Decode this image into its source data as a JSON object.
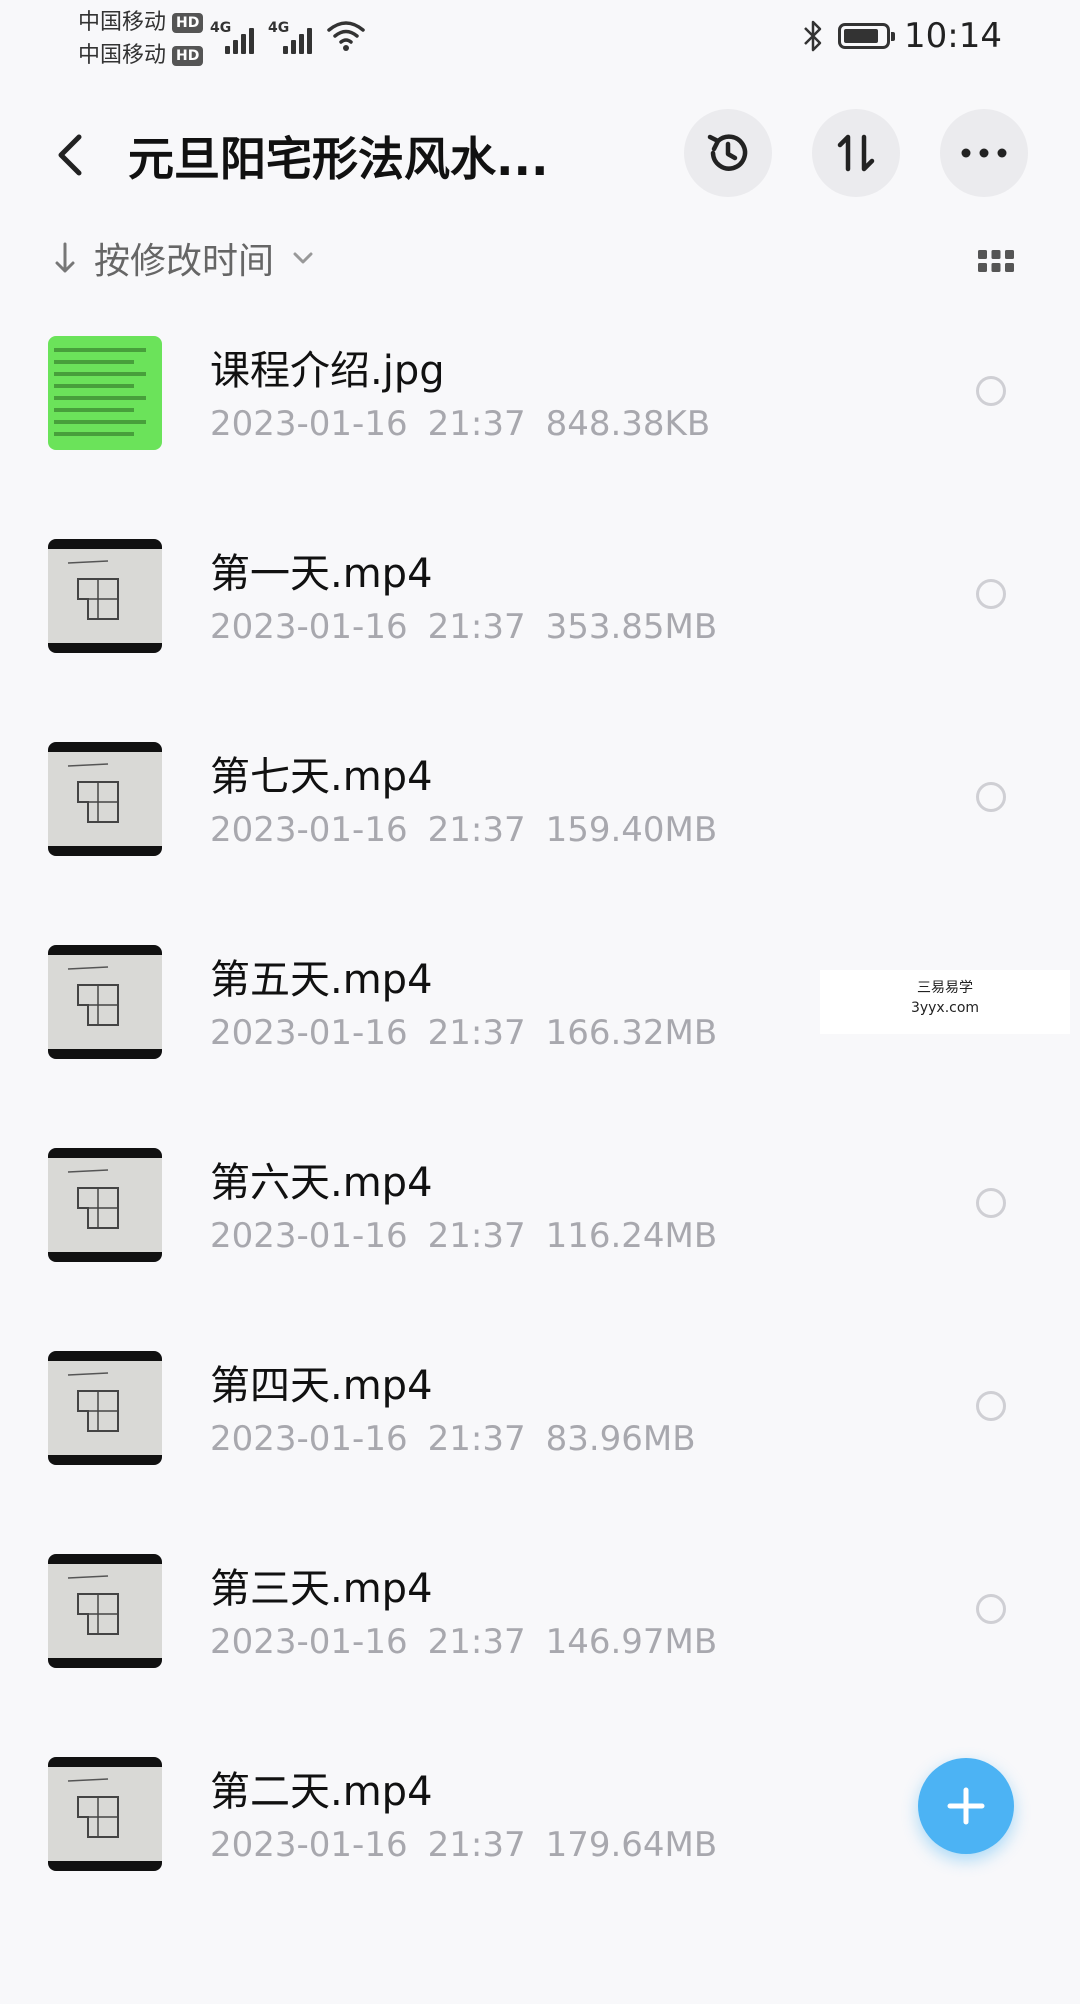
{
  "status_bar": {
    "carrier_1": "中国移动",
    "carrier_2": "中国移动",
    "hd_badge": "HD",
    "network_1": "4G",
    "network_2": "4G",
    "time": "10:14",
    "icons": [
      "signal-icon",
      "wifi-icon",
      "bluetooth-icon",
      "battery-icon"
    ],
    "battery_level": 0.85
  },
  "header": {
    "title": "元旦阳宅形法风水...",
    "icons": [
      "back-icon",
      "history-icon",
      "sort-icon",
      "more-icon"
    ]
  },
  "sort": {
    "label": "按修改时间",
    "icons": [
      "down-arrow-icon",
      "chevron-down-icon",
      "grid-view-icon"
    ]
  },
  "files": [
    {
      "name": "课程介绍.jpg",
      "date": "2023-01-16",
      "time": "21:37",
      "size": "848.38KB",
      "thumb": "image"
    },
    {
      "name": "第一天.mp4",
      "date": "2023-01-16",
      "time": "21:37",
      "size": "353.85MB",
      "thumb": "video"
    },
    {
      "name": "第七天.mp4",
      "date": "2023-01-16",
      "time": "21:37",
      "size": "159.40MB",
      "thumb": "video"
    },
    {
      "name": "第五天.mp4",
      "date": "2023-01-16",
      "time": "21:37",
      "size": "166.32MB",
      "thumb": "video"
    },
    {
      "name": "第六天.mp4",
      "date": "2023-01-16",
      "time": "21:37",
      "size": "116.24MB",
      "thumb": "video"
    },
    {
      "name": "第四天.mp4",
      "date": "2023-01-16",
      "time": "21:37",
      "size": "83.96MB",
      "thumb": "video"
    },
    {
      "name": "第三天.mp4",
      "date": "2023-01-16",
      "time": "21:37",
      "size": "146.97MB",
      "thumb": "video"
    },
    {
      "name": "第二天.mp4",
      "date": "2023-01-16",
      "time": "21:37",
      "size": "179.64MB",
      "thumb": "video"
    }
  ],
  "watermark": {
    "line1": "三易易学",
    "line2": "3yyx.com"
  },
  "fab_icon": "plus-icon",
  "colors": {
    "accent": "#4cb3f4",
    "background": "#f8f8fa",
    "meta_text": "#a8a8ae",
    "image_thumb": "#6be35a"
  }
}
